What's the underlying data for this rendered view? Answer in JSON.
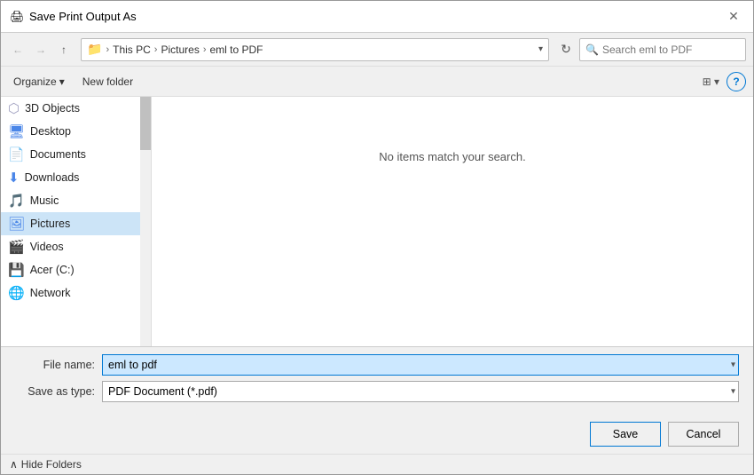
{
  "dialog": {
    "title": "Save Print Output As",
    "title_icon": "🖨",
    "close_label": "✕"
  },
  "nav": {
    "back_label": "←",
    "forward_label": "→",
    "up_label": "↑",
    "refresh_label": "↻",
    "dropdown_label": "▾",
    "breadcrumb": {
      "icon": "📁",
      "items": [
        "This PC",
        "Pictures",
        "eml to PDF"
      ]
    },
    "search_placeholder": "Search eml to PDF"
  },
  "toolbar": {
    "organize_label": "Organize",
    "organize_arrow": "▾",
    "new_folder_label": "New folder",
    "view_icon": "⊞",
    "view_arrow": "▾",
    "help_label": "?"
  },
  "sidebar": {
    "items": [
      {
        "id": "3d-objects",
        "icon": "⬡",
        "icon_color": "#a0a0c0",
        "label": "3D Objects"
      },
      {
        "id": "desktop",
        "icon": "🖥",
        "icon_color": "#4a86e8",
        "label": "Desktop"
      },
      {
        "id": "documents",
        "icon": "📄",
        "icon_color": "#888",
        "label": "Documents"
      },
      {
        "id": "downloads",
        "icon": "⬇",
        "icon_color": "#4a86e8",
        "label": "Downloads"
      },
      {
        "id": "music",
        "icon": "🎵",
        "icon_color": "#c040c0",
        "label": "Music"
      },
      {
        "id": "pictures",
        "icon": "🖼",
        "icon_color": "#4a86e8",
        "label": "Pictures"
      },
      {
        "id": "videos",
        "icon": "🎬",
        "icon_color": "#4040d0",
        "label": "Videos"
      },
      {
        "id": "acer-c",
        "icon": "💾",
        "icon_color": "#888",
        "label": "Acer (C:)"
      },
      {
        "id": "network",
        "icon": "🌐",
        "icon_color": "#60a060",
        "label": "Network"
      }
    ]
  },
  "content": {
    "empty_message": "No items match your search."
  },
  "form": {
    "filename_label": "File name:",
    "filename_value": "eml to pdf",
    "savetype_label": "Save as type:",
    "savetype_value": "PDF Document (*.pdf)"
  },
  "buttons": {
    "save_label": "Save",
    "cancel_label": "Cancel",
    "hide_folders_icon": "∧",
    "hide_folders_label": "Hide Folders"
  }
}
